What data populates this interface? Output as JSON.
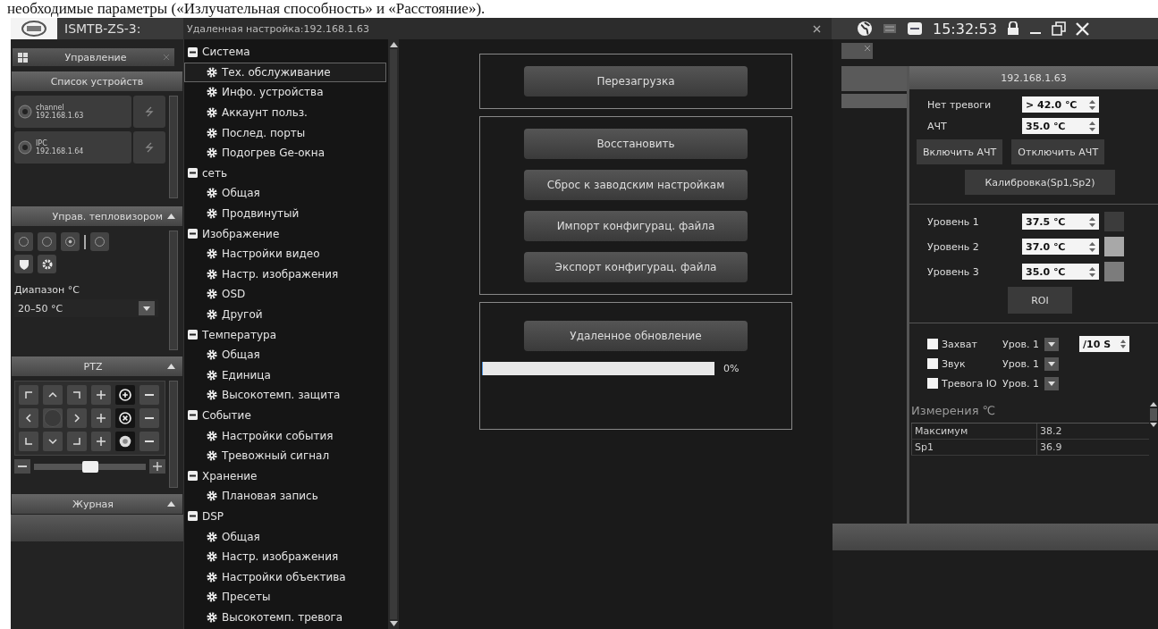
{
  "document_caption": "необходимые параметры («Излучательная способность» и «Расстояние»).",
  "app": {
    "title": "ISMTB-ZS-3:",
    "time": "15:32:53"
  },
  "dialog": {
    "title": "Удаленная настройка:192.168.1.63"
  },
  "left_panel": {
    "tab": "Управление",
    "device_list": {
      "title": "Список устройств",
      "devices": [
        {
          "name": "channel",
          "address": "192.168.1.63"
        },
        {
          "name": "IPC",
          "address": "192.168.1.64"
        }
      ]
    },
    "thermal": {
      "title": "Управ. тепловизором",
      "expanded": true,
      "range_label": "Диапазон °C",
      "range_value": "20–50 °C"
    },
    "ptz": {
      "title": "PTZ",
      "expanded": true,
      "zoom_slider": {
        "level": 0.5
      }
    },
    "log": {
      "title": "Журная",
      "expanded": true
    }
  },
  "tree": [
    {
      "label": "Система",
      "expanded": true,
      "children": [
        {
          "label": "Тех. обслуживание",
          "selected": true
        },
        {
          "label": "Инфо. устройства",
          "selected": false
        },
        {
          "label": "Аккаунт польз.",
          "selected": false
        },
        {
          "label": "Послед. порты",
          "selected": false
        },
        {
          "label": "Подогрев Ge-окна",
          "selected": false
        }
      ]
    },
    {
      "label": "сеть",
      "expanded": true,
      "children": [
        {
          "label": "Общая",
          "selected": false
        },
        {
          "label": "Продвинутый",
          "selected": false
        }
      ]
    },
    {
      "label": "Изображение",
      "expanded": true,
      "children": [
        {
          "label": "Настройки видео",
          "selected": false
        },
        {
          "label": "Настр. изображения",
          "selected": false
        },
        {
          "label": "OSD",
          "selected": false
        },
        {
          "label": "Другой",
          "selected": false
        }
      ]
    },
    {
      "label": "Температура",
      "expanded": true,
      "children": [
        {
          "label": "Общая",
          "selected": false
        },
        {
          "label": "Единица",
          "selected": false
        },
        {
          "label": "Высокотемп. защита",
          "selected": false
        }
      ]
    },
    {
      "label": "Событие",
      "expanded": true,
      "children": [
        {
          "label": "Настройки события",
          "selected": false
        },
        {
          "label": "Тревожный сигнал",
          "selected": false
        }
      ]
    },
    {
      "label": "Хранение",
      "expanded": true,
      "children": [
        {
          "label": "Плановая запись",
          "selected": false
        }
      ]
    },
    {
      "label": "DSP",
      "expanded": true,
      "children": [
        {
          "label": "Общая",
          "selected": false
        },
        {
          "label": "Настр. изображения",
          "selected": false
        },
        {
          "label": "Настройки объектива",
          "selected": false
        },
        {
          "label": "Пресеты",
          "selected": false
        },
        {
          "label": "Высокотемп. тревога",
          "selected": false
        }
      ]
    }
  ],
  "maintenance": [
    {
      "buttons": [
        "Перезагрузка"
      ]
    },
    {
      "buttons": [
        "Восстановить",
        "Сброс к заводским настройкам",
        "Импорт конфигурац. файла",
        "Экспорт конфигурац. файла"
      ]
    },
    {
      "buttons": [
        "Удаленное обновление"
      ],
      "progress": {
        "level": 0,
        "reading": "0%"
      }
    }
  ],
  "right_panel": {
    "title": "192.168.1.63",
    "alarm_fields": [
      {
        "label": "Нет тревоги",
        "value": "> 42.0 ℃"
      },
      {
        "label": "АЧТ",
        "value": "35.0 ℃"
      }
    ],
    "buttons": [
      "Включить АЧТ",
      "Отключить АЧТ"
    ],
    "calibrate": "Калибровка(Sp1,Sp2)",
    "levels": [
      {
        "label": "Уровень 1",
        "value": "37.5 ℃",
        "color": "#3c3c3c"
      },
      {
        "label": "Уровень 2",
        "value": "37.0 ℃",
        "color": "#a8a8a8"
      },
      {
        "label": "Уровень 3",
        "value": "35.0 ℃",
        "color": "#7c7c7c"
      }
    ],
    "roi": "ROI",
    "actions": [
      {
        "label": "Захват",
        "checked": false,
        "level": "Уров. 1",
        "interval": "/10 S"
      },
      {
        "label": "Звук",
        "checked": false,
        "level": "Уров. 1"
      },
      {
        "label": "Тревога IO",
        "checked": false,
        "level": "Уров. 1"
      }
    ],
    "measurements": {
      "title": "Измерения ℃",
      "rows": [
        [
          "Максимум",
          "38.2"
        ],
        [
          "Sp1",
          "36.9"
        ]
      ]
    }
  }
}
